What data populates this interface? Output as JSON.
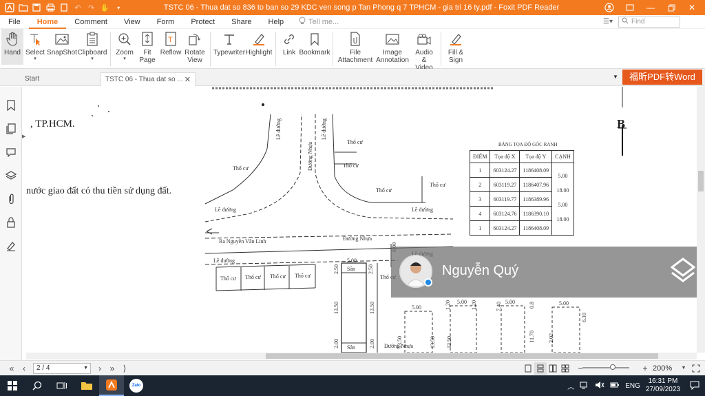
{
  "window": {
    "title": "TSTC 06 - Thua dat so 836 to ban so 29 KDC ven song p Tan Phong q 7 TPHCM - gia tri 16 ty.pdf - Foxit PDF Reader",
    "colors": {
      "titlebar": "#f47a20",
      "accent": "#f47a20",
      "badge": "#e6581c"
    }
  },
  "menu": {
    "items": [
      "File",
      "Home",
      "Comment",
      "View",
      "Form",
      "Protect",
      "Share",
      "Help"
    ],
    "active": "Home",
    "tell_me": "Tell me...",
    "find_placeholder": "Find"
  },
  "ribbon": {
    "hand": "Hand",
    "select": "Select",
    "snapshot": "SnapShot",
    "clipboard": "Clipboard",
    "zoom": "Zoom",
    "fit_page_1": "Fit",
    "fit_page_2": "Page",
    "reflow": "Reflow",
    "rotate_1": "Rotate",
    "rotate_2": "View",
    "typewriter": "Typewriter",
    "highlight": "Highlight",
    "link": "Link",
    "bookmark": "Bookmark",
    "file_attach_1": "File",
    "file_attach_2": "Attachment",
    "image_annot_1": "Image",
    "image_annot_2": "Annotation",
    "audio_video_1": "Audio",
    "audio_video_2": "& Video",
    "fill_sign_1": "Fill &",
    "fill_sign_2": "Sign"
  },
  "tabs": {
    "start": "Start",
    "current": "TSTC 06 - Thua dat so ...",
    "pdf_to_word": "福昕PDF转Word"
  },
  "document": {
    "city": ", TP.HCM.",
    "land_text": "nước giao đất có thu tiền sử dụng đất.",
    "corner_letter": "B",
    "map_labels": {
      "le_duong": "Lề đường",
      "duong_nhua": "Đường Nhựa",
      "tho_cu": "Thổ cư",
      "street": "Ra Nguyễn Văn Linh",
      "san": "Sân"
    },
    "table": {
      "title": "BẢNG TỌA ĐỘ GÓC RANH",
      "headers": [
        "ĐIỂM",
        "Tọa độ X",
        "Tọa độ Y",
        "CẠNH"
      ],
      "rows": [
        [
          "1",
          "603124.27",
          "1186408.09"
        ],
        [
          "2",
          "603119.27",
          "1186407.96"
        ],
        [
          "3",
          "603119.77",
          "1186389.96"
        ],
        [
          "4",
          "603124.76",
          "1186390.10"
        ],
        [
          "1",
          "603124.27",
          "1186408.09"
        ]
      ],
      "edges": [
        "5.00",
        "18.00",
        "5.00",
        "18.00"
      ]
    },
    "dims": [
      "5.00",
      "2.50",
      "13.50",
      "2.00",
      "6.00",
      "1.20",
      "7.40",
      "0.8",
      "11.70",
      "2.02",
      "6.10",
      "2.50"
    ]
  },
  "overlay": {
    "name": "Nguyễn Quý"
  },
  "status": {
    "page": "2 / 4",
    "zoom": "200%"
  },
  "taskbar": {
    "lang": "ENG",
    "time": "16:31 PM",
    "date": "27/09/2023",
    "zalo": "Zalo"
  }
}
